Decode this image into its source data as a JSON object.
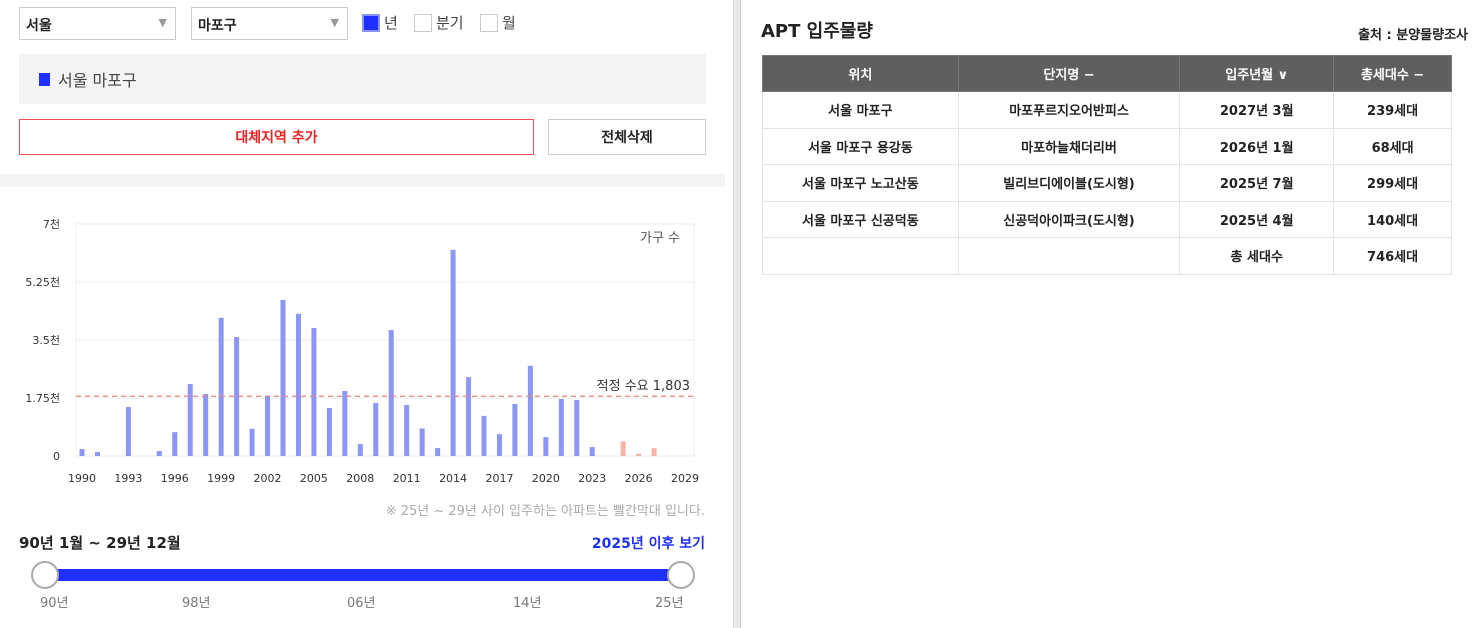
{
  "filters": {
    "city": "서울",
    "district": "마포구",
    "periods": [
      {
        "label": "년",
        "checked": true
      },
      {
        "label": "분기",
        "checked": false
      },
      {
        "label": "월",
        "checked": false
      }
    ]
  },
  "legend": {
    "label": "서울 마포구",
    "color": "#1e2fff"
  },
  "buttons": {
    "add_region": "대체지역 추가",
    "delete_all": "전체삭제"
  },
  "chart_data": {
    "type": "bar",
    "title": "",
    "ylabel": "가구 수",
    "xlabel": "",
    "ylim": [
      0,
      7000
    ],
    "yticks": [
      {
        "v": 0,
        "label": "0"
      },
      {
        "v": 1750,
        "label": "1.75천"
      },
      {
        "v": 3500,
        "label": "3.5천"
      },
      {
        "v": 5250,
        "label": "5.25천"
      },
      {
        "v": 7000,
        "label": "7천"
      }
    ],
    "xticks": [
      "1990",
      "1993",
      "1996",
      "1999",
      "2002",
      "2005",
      "2008",
      "2011",
      "2014",
      "2017",
      "2020",
      "2023",
      "2026",
      "2029"
    ],
    "categories": [
      1990,
      1991,
      1992,
      1993,
      1994,
      1995,
      1996,
      1997,
      1998,
      1999,
      2000,
      2001,
      2002,
      2003,
      2004,
      2005,
      2006,
      2007,
      2008,
      2009,
      2010,
      2011,
      2012,
      2013,
      2014,
      2015,
      2016,
      2017,
      2018,
      2019,
      2020,
      2021,
      2022,
      2023,
      2024,
      2025,
      2026,
      2027,
      2028,
      2029
    ],
    "values": [
      210,
      120,
      0,
      1480,
      0,
      150,
      720,
      2170,
      1870,
      4170,
      3590,
      820,
      1810,
      4710,
      4290,
      3860,
      1450,
      1960,
      360,
      1600,
      3800,
      1540,
      830,
      240,
      6220,
      2380,
      1210,
      660,
      1570,
      2720,
      570,
      1720,
      1690,
      270,
      0,
      439,
      68,
      239,
      0,
      0
    ],
    "future_from": 2025,
    "colors": {
      "past": "#8c96f7",
      "future": "#f8b3a3",
      "demand": "#f08080"
    },
    "reference": {
      "value": 1803,
      "label": "적정 수요 1,803"
    }
  },
  "note": "※ 25년 ~ 29년 사이 입주하는 아파트는 빨간막대 입니다.",
  "range": {
    "label": "90년 1월 ~ 29년 12월",
    "after_link": "2025년 이후 보기",
    "ticks": [
      "90년",
      "98년",
      "06년",
      "14년",
      "25년"
    ],
    "start": 0,
    "end": 1
  },
  "table": {
    "title": "APT 입주물량",
    "source": "출처 : 분양물량조사",
    "headers": [
      "위치",
      "단지명 −",
      "입주년월 ∨",
      "총세대수 −"
    ],
    "rows": [
      [
        "서울 마포구",
        "마포푸르지오어반피스",
        "2027년 3월",
        "239세대"
      ],
      [
        "서울 마포구 용강동",
        "마포하늘채더리버",
        "2026년 1월",
        "68세대"
      ],
      [
        "서울 마포구 노고산동",
        "빌리브디에이블(도시형)",
        "2025년 7월",
        "299세대"
      ],
      [
        "서울 마포구 신공덕동",
        "신공덕아이파크(도시형)",
        "2025년 4월",
        "140세대"
      ]
    ],
    "total_label": "총 세대수",
    "total_value": "746세대"
  }
}
